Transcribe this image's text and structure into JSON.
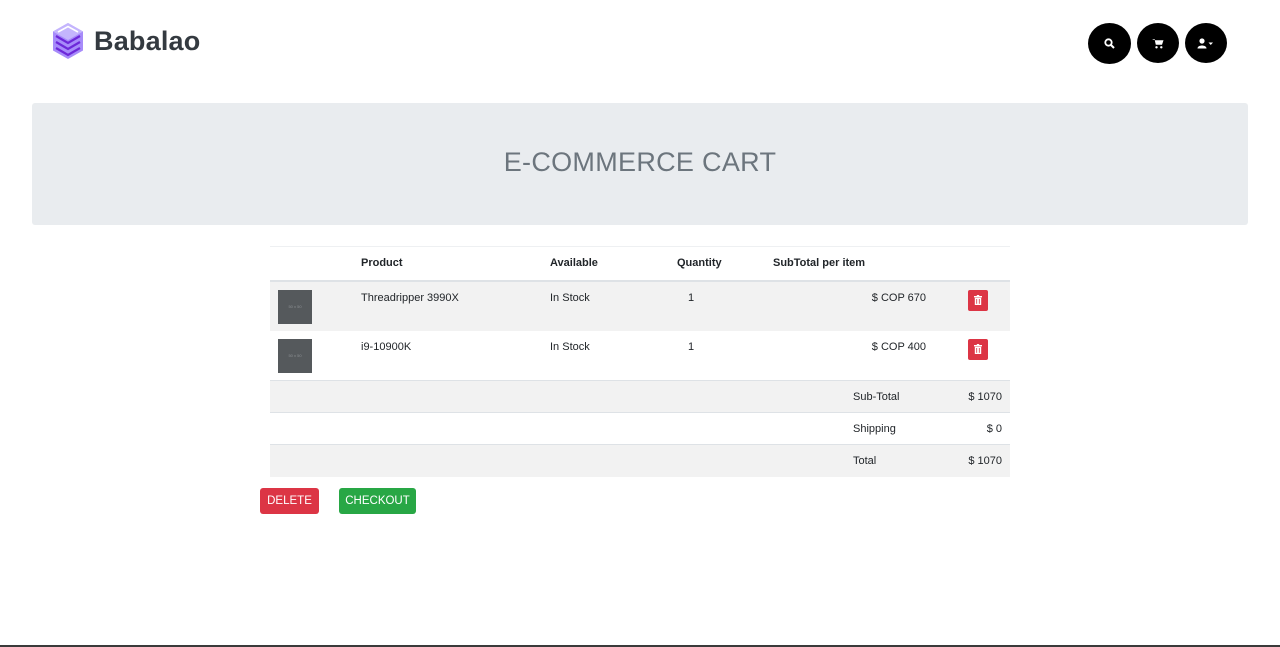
{
  "brand": {
    "name": "Babalao"
  },
  "nav": {
    "icons": [
      "search-icon",
      "cart-icon",
      "user-dropdown-icon"
    ]
  },
  "jumbotron": {
    "title": "E-COMMERCE CART"
  },
  "table": {
    "headers": {
      "image": "",
      "product": "Product",
      "available": "Available",
      "quantity": "Quantity",
      "subtotal": "SubTotal per item",
      "action": ""
    },
    "items": [
      {
        "thumb": "50 x 50",
        "product": "Threadripper 3990X",
        "available": "In Stock",
        "quantity": "1",
        "subtotal": "$ COP 670"
      },
      {
        "thumb": "50 x 50",
        "product": "i9-10900K",
        "available": "In Stock",
        "quantity": "1",
        "subtotal": "$ COP 400"
      }
    ],
    "summary": {
      "subtotal_label": "Sub-Total",
      "subtotal_value": "$ 1070",
      "shipping_label": "Shipping",
      "shipping_value": "$ 0",
      "total_label": "Total",
      "total_value": "$ 1070"
    }
  },
  "actions": {
    "delete_label": "DELETE",
    "checkout_label": "CHECKOUT"
  },
  "colors": {
    "brand_logo": "#8b5cf6",
    "danger": "#dc3545",
    "success": "#28a745",
    "jumbotron_bg": "#e9ecef"
  }
}
